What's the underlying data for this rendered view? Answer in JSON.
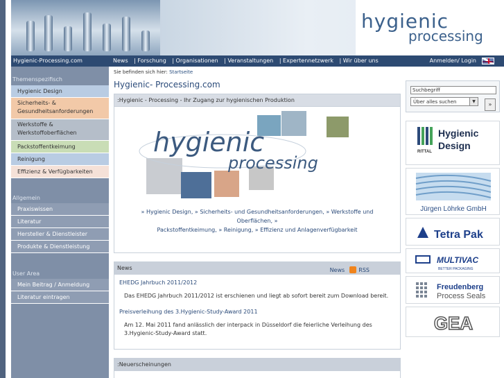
{
  "header": {
    "logo_line1": "hygienic",
    "logo_line2": "processing"
  },
  "navbar": {
    "site_name": "Hygienic-Processing.com",
    "links": [
      "News",
      "| Forschung",
      "| Organisationen",
      "| Veranstaltungen",
      "| Expertennetzwerk",
      "| Wir über uns"
    ],
    "login": "Anmelden/ Login"
  },
  "sidebar": {
    "section1": "Themenspezifisch",
    "items1": [
      "Hygienic Design",
      "Sicherheits- &",
      "Gesundheitsanforderungen",
      "Werkstoffe &",
      "Werkstoffoberflächen",
      "Packstoffentkeimung",
      "Reinigung",
      "Effizienz & Verfügbarkeiten"
    ],
    "section2": "Allgemein",
    "items2": [
      "Praxiswissen",
      "Literatur",
      "Hersteller & Dienstleister",
      "Produkte & Dienstleistung"
    ],
    "section3": "User Area",
    "items3": [
      "Mein Beitrag / Anmeldung",
      "Literatur eintragen"
    ]
  },
  "breadcrumb": {
    "prefix": "Sie befinden sich hier:",
    "link": "Startseite"
  },
  "main": {
    "title": "Hygienic- Processing.com",
    "intro_header": ":Hygienic - Processing - Ihr Zugang zur hygienischen Produktion",
    "art_line1": "hygienic",
    "art_line2": "processing",
    "promo_line1": "» Hygienic Design, » Sicherheits- und Gesundheitsanforderungen, » Werkstoffe und Oberflächen, »",
    "promo_line2": "Packstoffentkeimung, » Reinigung, » Effizienz und Anlagenverfügbarkeit",
    "news_header": "News",
    "news_link": "News",
    "rss": "RSS",
    "news": [
      {
        "title": "EHEDG Jahrbuch 2011/2012",
        "text": "Das EHEDG Jahrbuch 2011/2012 ist erschienen und liegt ab sofort bereit zum Download bereit."
      },
      {
        "title": "Preisverleihung des 3.Hygienic-Study-Award 2011",
        "text": "Am 12. Mai 2011 fand anlässlich der interpack in Düsseldorf die feierliche Verleihung des 3.Hygienic-Study-Award statt."
      }
    ],
    "new_header": ":Neuerscheinungen"
  },
  "search": {
    "placeholder": "Suchbegriff",
    "select_value": "Über alles suchen",
    "button": "»"
  },
  "sponsors": {
    "s1_line1": "Hygienic",
    "s1_line2": "Design",
    "s1_sub": "RITTAL",
    "s2": "Jürgen Löhrke GmbH",
    "s3": "Tetra Pak",
    "s4": "MULTIVAC",
    "s4_sub": "BETTER PACKAGING",
    "s5_line1": "Freudenberg",
    "s5_line2": "Process Seals",
    "s6": "GEA"
  },
  "colors": {
    "nav": "#2d4a72",
    "sidebar": "#7f8fa7",
    "accent": "#2a4a79"
  }
}
